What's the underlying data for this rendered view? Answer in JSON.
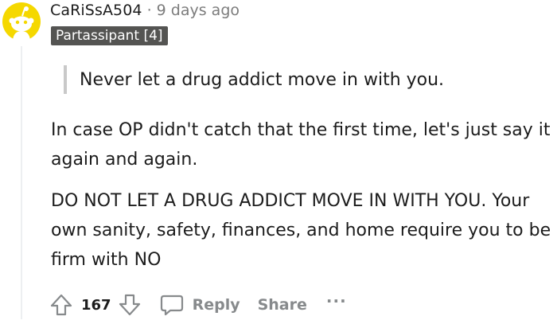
{
  "comment": {
    "username": "CaRiSsA504",
    "separator": "·",
    "time": "9 days ago",
    "flair": "Partassipant [4]",
    "quote": "Never let a drug addict move in with you.",
    "paragraphs": [
      "In case OP didn't catch that the first time, let's just say it again and again.",
      "DO NOT LET A DRUG ADDICT MOVE IN WITH YOU. Your own sanity, safety, finances, and home require you to be firm with NO"
    ]
  },
  "actions": {
    "vote_count": "167",
    "reply_label": "Reply",
    "share_label": "Share",
    "more_label": "···"
  },
  "icons": {
    "avatar": "snoo-avatar-icon",
    "upvote": "upvote-arrow-icon",
    "downvote": "downvote-arrow-icon",
    "reply": "speech-bubble-icon"
  },
  "colors": {
    "avatar_bg": "#f5d800",
    "flair_bg": "#545452",
    "muted_text": "#878a8c",
    "quote_bar": "#c9c9c9"
  }
}
